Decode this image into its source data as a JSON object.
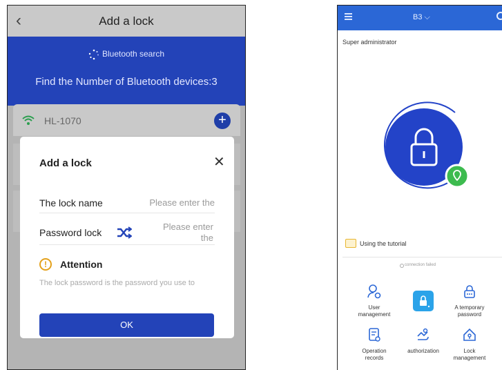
{
  "left_screen": {
    "header": {
      "back_icon": "chevron-left-icon",
      "title": "Add a lock"
    },
    "bluetooth": {
      "search_label": "Bluetooth search",
      "count_text": "Find the Number of Bluetooth devices:3"
    },
    "device": {
      "name": "HL-1070",
      "add_icon": "plus-icon"
    },
    "dialog": {
      "title": "Add a lock",
      "close_icon": "close-icon",
      "lock_name_label": "The lock name",
      "lock_name_placeholder": "Please enter the",
      "password_label": "Password lock",
      "password_placeholder_line1": "Please enter",
      "password_placeholder_line2": "the",
      "attention_title": "Attention",
      "attention_text": "The lock password is the password you use to",
      "ok_label": "OK"
    },
    "colors": {
      "primary": "#2343b8",
      "overlay": "#b4b4b4",
      "warning": "#e4a11b"
    }
  },
  "right_screen": {
    "header": {
      "title": "B3 ⌵",
      "menu_icon": "hamburger-icon",
      "settings_icon": "gear-icon"
    },
    "role": "Super administrator",
    "tutorial": "Using the tutorial",
    "connection_status": "connection failed",
    "tiles": [
      {
        "label": "User\nmanagement",
        "icon": "user-settings-icon"
      },
      {
        "label": "",
        "icon": "lock-button-icon"
      },
      {
        "label": "A temporary\npassword",
        "icon": "temporary-password-icon"
      },
      {
        "label": "Operation\nrecords",
        "icon": "records-icon"
      },
      {
        "label": "authorization",
        "icon": "authorization-icon"
      },
      {
        "label": "Lock\nmanagement",
        "icon": "home-lock-icon"
      }
    ],
    "colors": {
      "primary": "#2b67d6",
      "lock_circle": "#2343c8",
      "status_green": "#3dbb4f"
    }
  }
}
